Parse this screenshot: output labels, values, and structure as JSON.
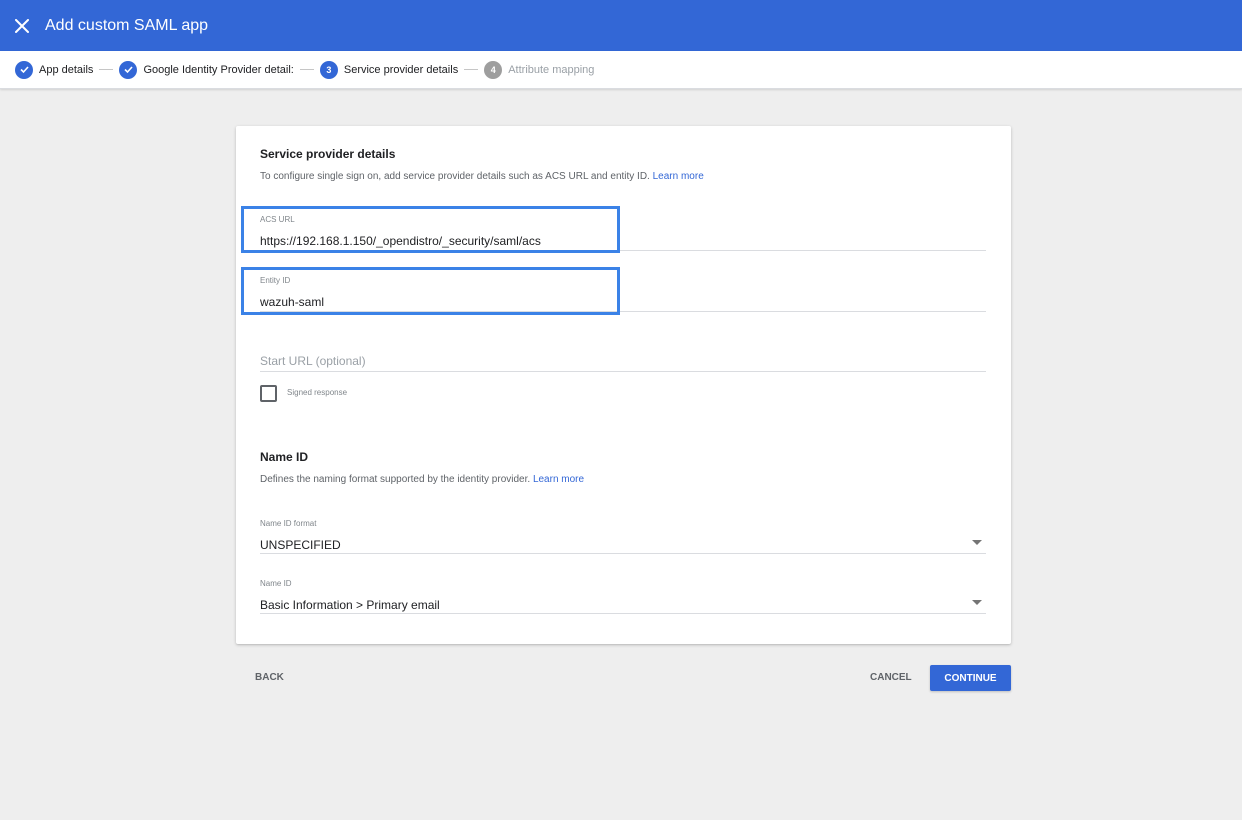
{
  "header": {
    "title": "Add custom SAML app",
    "close_icon": "close-icon",
    "color": "#3367d6"
  },
  "stepper": {
    "steps": [
      {
        "label": "App details",
        "state": "done",
        "number": ""
      },
      {
        "label": "Google Identity Provider detail:",
        "state": "done",
        "number": ""
      },
      {
        "label": "Service provider details",
        "state": "active",
        "number": "3"
      },
      {
        "label": "Attribute mapping",
        "state": "pending",
        "number": "4"
      }
    ]
  },
  "service_provider": {
    "title": "Service provider details",
    "description": "To configure single sign on, add service provider details such as ACS URL and entity ID.",
    "learn_more": "Learn more",
    "acs_url": {
      "label": "ACS URL",
      "value": "https://192.168.1.150/_opendistro/_security/saml/acs"
    },
    "entity_id": {
      "label": "Entity ID",
      "value": "wazuh-saml"
    },
    "start_url": {
      "placeholder": "Start URL (optional)"
    },
    "signed_response": {
      "label": "Signed response",
      "checked": false
    }
  },
  "name_id": {
    "title": "Name ID",
    "description": "Defines the naming format supported by the identity provider.",
    "learn_more": "Learn more",
    "format": {
      "label": "Name ID format",
      "value": "UNSPECIFIED"
    },
    "name_id": {
      "label": "Name ID",
      "value": "Basic Information > Primary email"
    }
  },
  "footer": {
    "back": "BACK",
    "cancel": "CANCEL",
    "continue": "CONTINUE"
  }
}
